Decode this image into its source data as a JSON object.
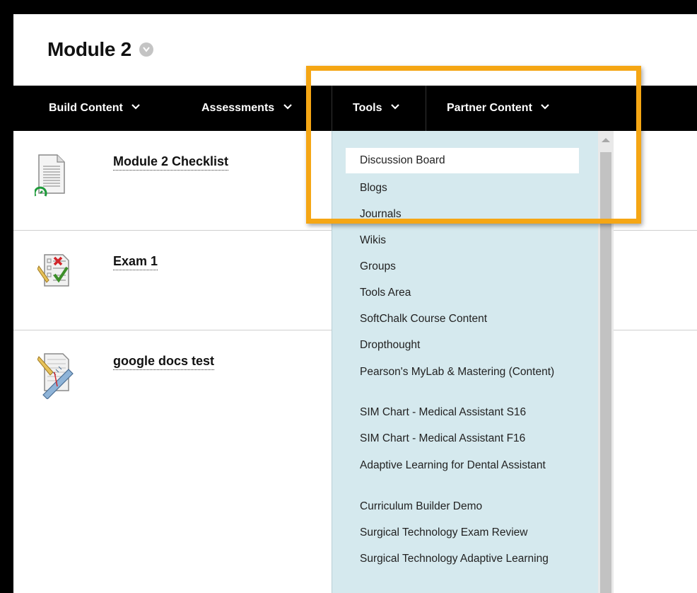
{
  "page": {
    "title": "Module 2"
  },
  "action_bar": {
    "menus": [
      {
        "label": "Build Content"
      },
      {
        "label": "Assessments"
      },
      {
        "label": "Tools"
      },
      {
        "label": "Partner Content"
      }
    ]
  },
  "content_items": [
    {
      "title": "Module 2 Checklist",
      "icon": "document-icon"
    },
    {
      "title": "Exam 1",
      "icon": "test-icon"
    },
    {
      "title": "google docs test",
      "icon": "assignment-icon"
    }
  ],
  "tools_menu": {
    "items": [
      "Discussion Board",
      "Blogs",
      "Journals",
      "Wikis",
      "Groups",
      "Tools Area",
      "SoftChalk Course Content",
      "Dropthought",
      "Pearson's MyLab & Mastering (Content)",
      "SIM Chart - Medical Assistant S16",
      "SIM Chart - Medical Assistant F16",
      "Adaptive Learning for Dental Assistant",
      "Curriculum Builder Demo",
      "Surgical Technology Exam Review",
      "Surgical Technology Adaptive Learning"
    ],
    "highlighted_item": "Discussion Board"
  },
  "colors": {
    "action_bar": "#000000",
    "dropdown_bg": "#d5e9ee",
    "highlight_border": "#f5a614",
    "adaptive_release_icon": "#1e9b3a"
  }
}
